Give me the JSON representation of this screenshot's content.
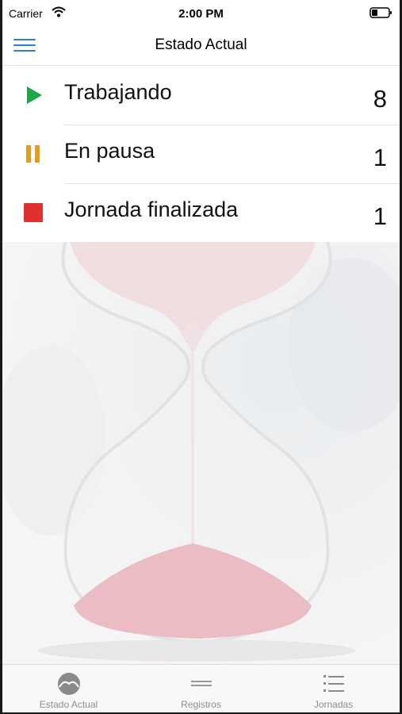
{
  "status_bar": {
    "carrier": "Carrier",
    "time": "2:00 PM"
  },
  "nav": {
    "title": "Estado Actual"
  },
  "rows": [
    {
      "label": "Trabajando",
      "count": "8",
      "icon": "play-icon",
      "color": "#1fa64a"
    },
    {
      "label": "En pausa",
      "count": "1",
      "icon": "pause-icon",
      "color": "#e49b1e"
    },
    {
      "label": "Jornada finalizada",
      "count": "1",
      "icon": "stop-icon",
      "color": "#e03030"
    }
  ],
  "tabs": [
    {
      "label": "Estado Actual",
      "icon": "gauge-icon",
      "selected": true
    },
    {
      "label": "Registros",
      "icon": "lines-icon",
      "selected": false
    },
    {
      "label": "Jornadas",
      "icon": "list-icon",
      "selected": false
    }
  ]
}
